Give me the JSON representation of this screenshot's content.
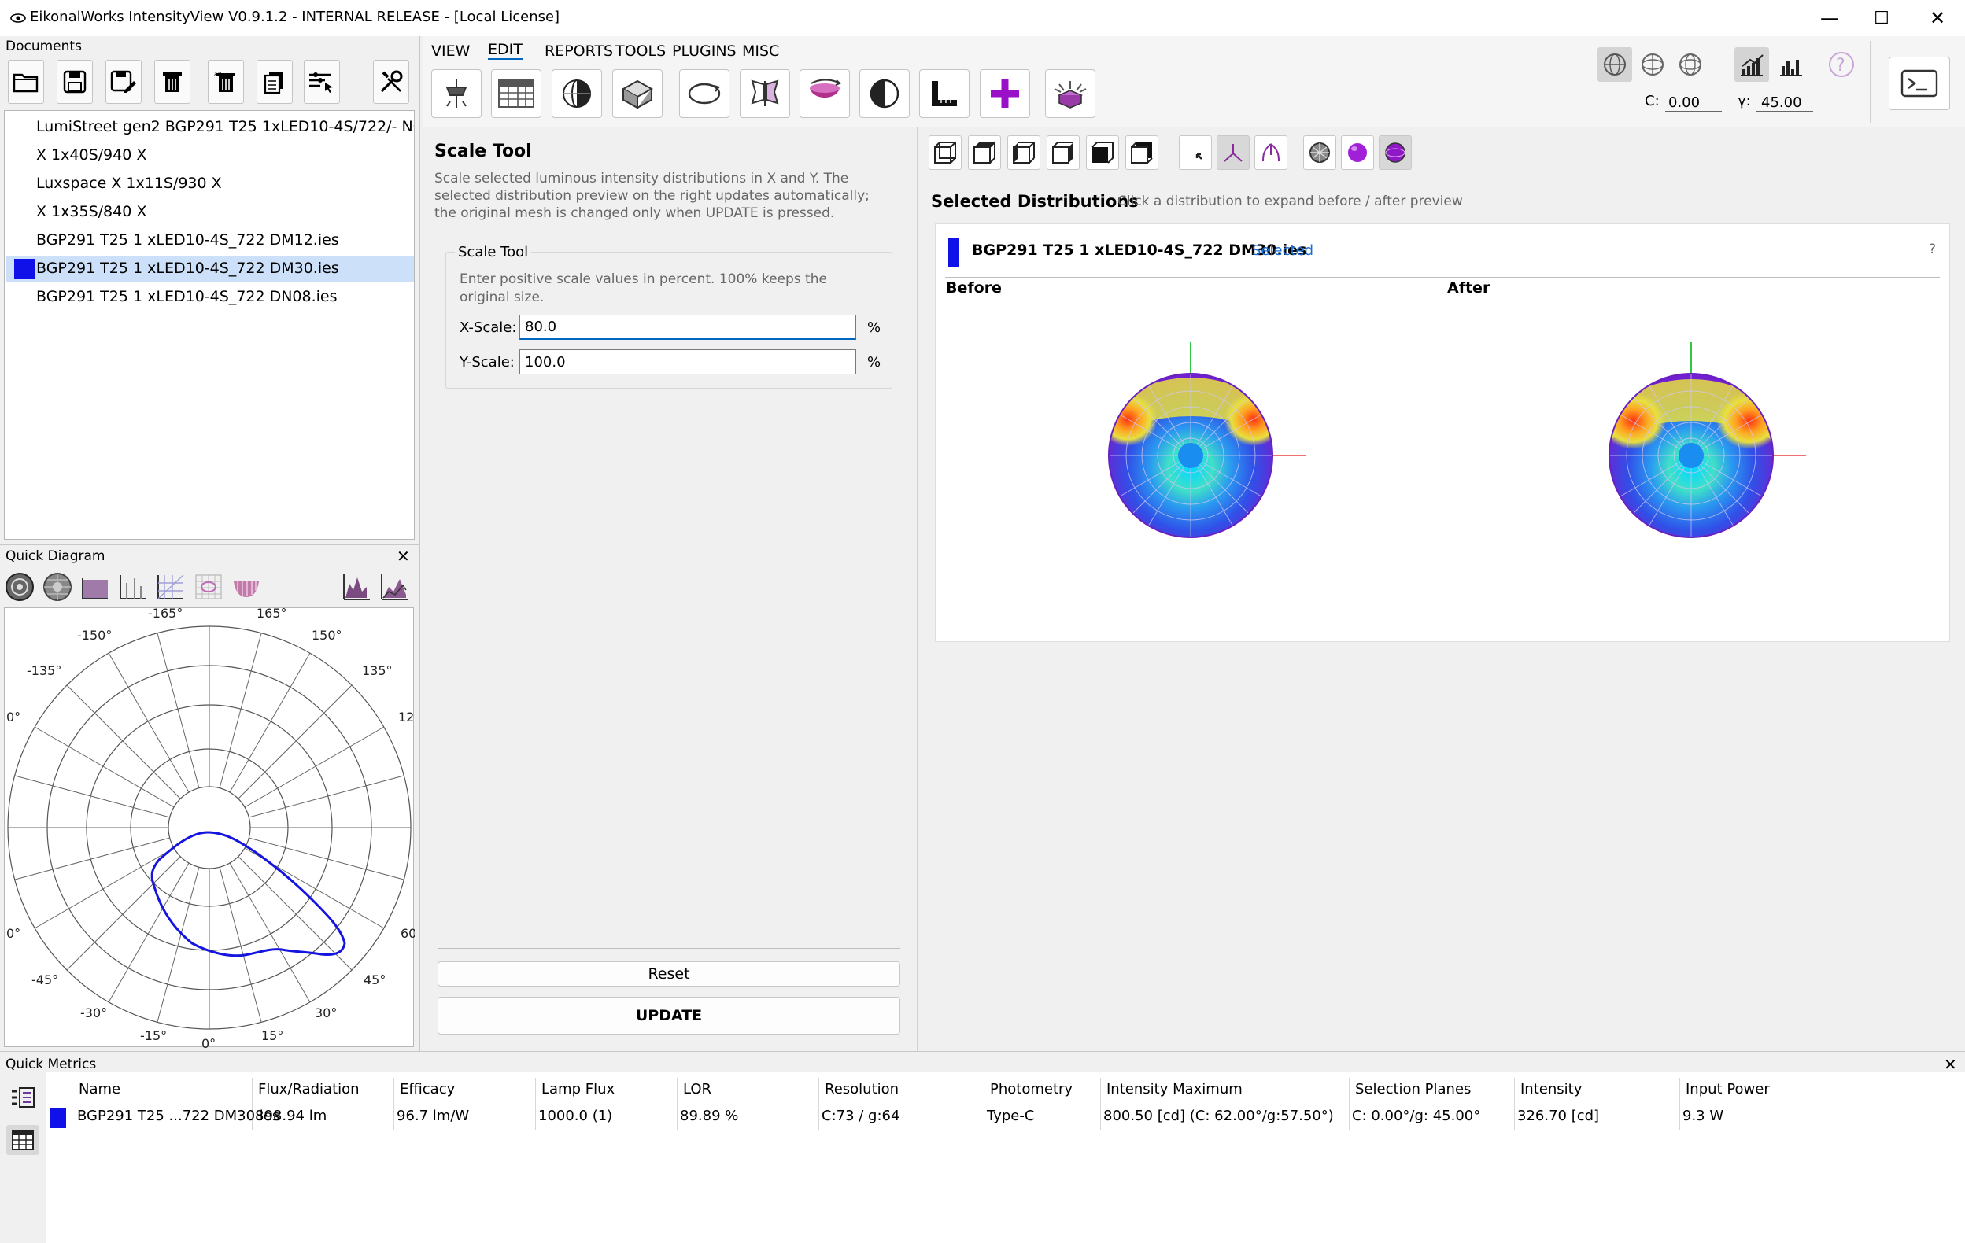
{
  "window": {
    "title": "EikonalWorks IntensityView V0.9.1.2 - INTERNAL RELEASE - [Local License]",
    "minimize": "—",
    "maximize": "☐",
    "close": "✕"
  },
  "documents": {
    "title": "Documents",
    "items": [
      {
        "label": "LumiStreet gen2 BGP291 T25 1xLED10-4S/722/- NO DN",
        "selected": false
      },
      {
        "label": "X 1x40S/940 X",
        "selected": false
      },
      {
        "label": "Luxspace X 1x11S/930 X",
        "selected": false
      },
      {
        "label": "X 1x35S/840 X",
        "selected": false
      },
      {
        "label": "BGP291 T25 1 xLED10-4S_722 DM12.ies",
        "selected": false
      },
      {
        "label": "BGP291 T25 1 xLED10-4S_722 DM30.ies",
        "selected": true
      },
      {
        "label": "BGP291 T25 1 xLED10-4S_722 DN08.ies",
        "selected": false
      }
    ]
  },
  "menu": {
    "tabs": [
      "VIEW",
      "EDIT",
      "REPORTS",
      "TOOLS",
      "PLUGINS",
      "MISC"
    ],
    "active": "EDIT"
  },
  "coords": {
    "c_label": "C:",
    "c_value": "0.00",
    "y_label": "γ:",
    "y_value": "45.00"
  },
  "scale_tool": {
    "heading": "Scale Tool",
    "description": "Scale selected luminous intensity distributions in X and Y. The selected distribution preview on the right updates automatically; the original mesh is changed only when UPDATE is pressed.",
    "group_title": "Scale Tool",
    "hint": "Enter positive scale values in percent. 100% keeps the original size.",
    "x_label": "X-Scale:",
    "x_value": "80.0",
    "y_label": "Y-Scale:",
    "y_value": "100.0",
    "unit": "%",
    "reset_label": "Reset",
    "update_label": "UPDATE"
  },
  "selected_distributions": {
    "title": "Selected Distributions",
    "hint": "Click a distribution to expand before / after preview",
    "item_name": "BGP291 T25 1 xLED10-4S_722 DM30.ies",
    "item_status": "Selected",
    "help": "?",
    "before_label": "Before",
    "after_label": "After"
  },
  "quick_diagram": {
    "title": "Quick Diagram",
    "close": "✕",
    "angle_labels": [
      "-165°",
      "165°",
      "-150°",
      "150°",
      "-135°",
      "135°",
      "0°",
      "12",
      "0°",
      "60",
      "-45°",
      "45°",
      "-30°",
      "30°",
      "-15°",
      "15°",
      "0°"
    ]
  },
  "quick_metrics": {
    "title": "Quick Metrics",
    "close": "✕",
    "columns": [
      "Name",
      "Flux/Radiation",
      "Efficacy",
      "Lamp Flux",
      "LOR",
      "Resolution",
      "Photometry",
      "Intensity Maximum",
      "Selection Planes",
      "Intensity",
      "Input Power"
    ],
    "row": [
      "BGP291 T25 ...722 DM30.ies",
      "898.94 lm",
      "96.7 lm/W",
      "1000.0 (1)",
      "89.89 %",
      "C:73 / g:64",
      "Type-C",
      "800.50 [cd] (C: 62.00°/g:57.50°)",
      "C: 0.00°/g: 45.00°",
      "326.70 [cd]",
      "9.3 W"
    ]
  },
  "colors": {
    "accent": "#0067c0",
    "selected_row": "#cce0fa",
    "series_blue": "#1010e8",
    "status_link": "#1a6fd1"
  }
}
